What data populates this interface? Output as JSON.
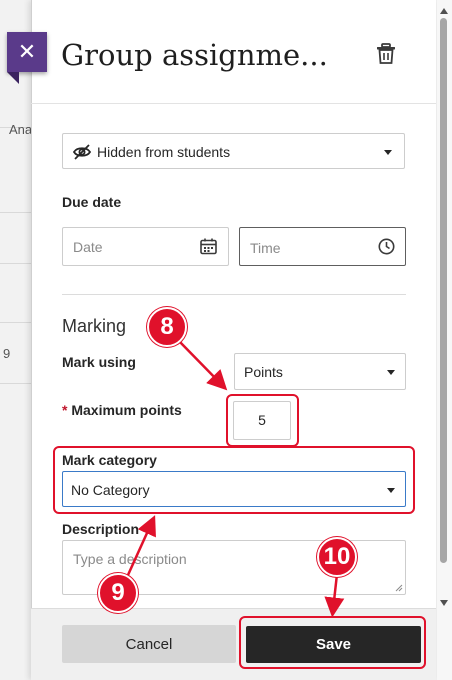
{
  "background": {
    "fragment_text": "Ana",
    "fragment_number": "9"
  },
  "panel": {
    "title": "Group assignme...",
    "visibility": {
      "selected": "Hidden from students"
    },
    "due_date": {
      "label": "Due date",
      "date_placeholder": "Date",
      "time_placeholder": "Time"
    },
    "marking": {
      "section_title": "Marking",
      "mark_using_label": "Mark using",
      "mark_using_value": "Points",
      "required_star": "*",
      "max_points_label": "Maximum points",
      "max_points_value": "5",
      "mark_category_label": "Mark category",
      "mark_category_value": "No Category"
    },
    "description": {
      "label": "Description",
      "placeholder": "Type a description"
    },
    "footer": {
      "cancel_label": "Cancel",
      "save_label": "Save"
    }
  },
  "annotations": {
    "badge_8": "8",
    "badge_9": "9",
    "badge_10": "10",
    "color": "#e0112b"
  },
  "colors": {
    "close_button": "#5a3a8a",
    "save_button": "#262626",
    "focus_border": "#3a7ac8"
  },
  "icons": [
    "close-icon",
    "trash-icon",
    "eye-slash-icon",
    "calendar-icon",
    "clock-icon",
    "chevron-down-icon"
  ]
}
